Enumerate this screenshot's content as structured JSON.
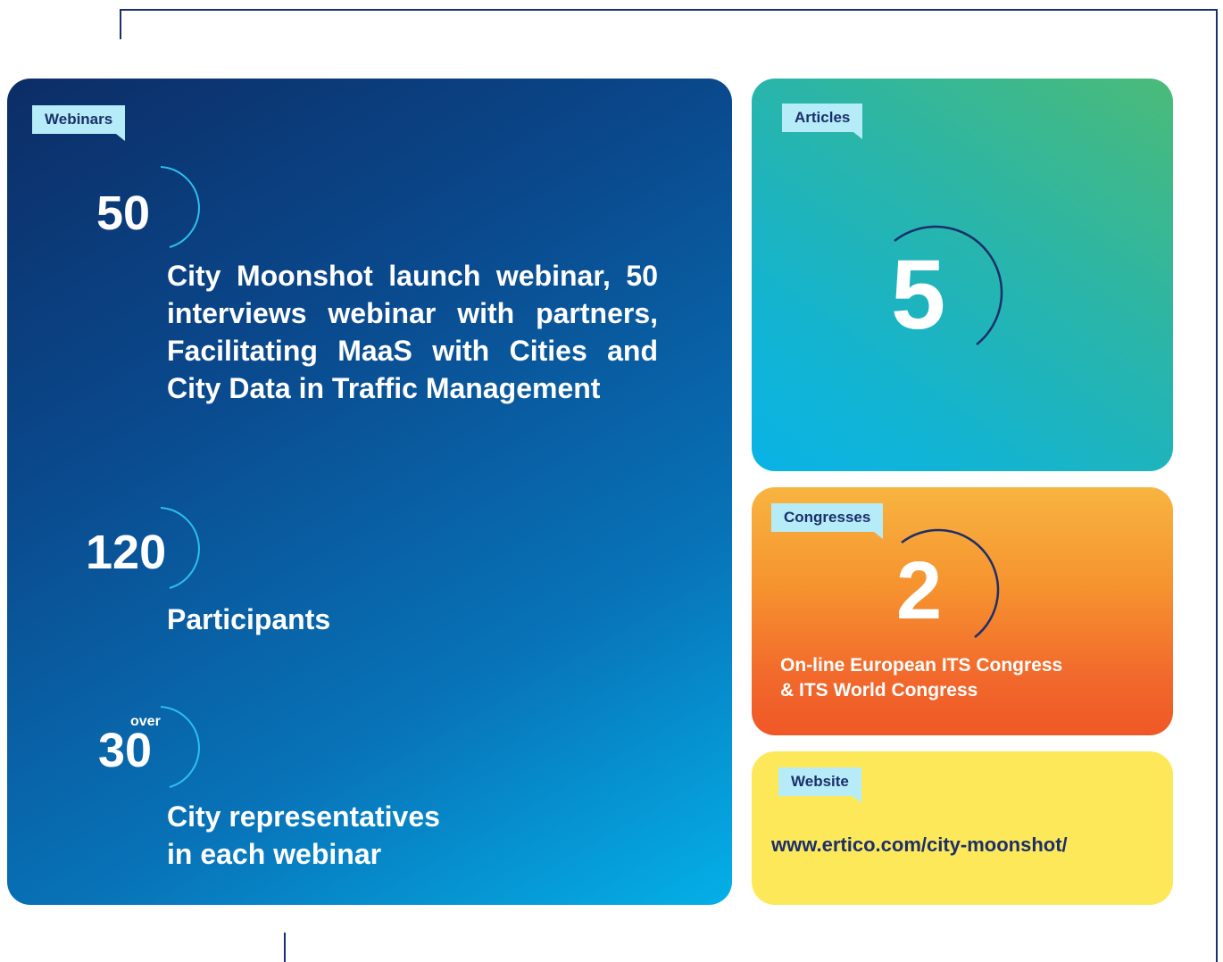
{
  "webinars": {
    "tag": "Webinars",
    "stat1": {
      "number": "50",
      "text": "City Moonshot launch webinar, 50 interviews webinar with partners, Facilitating MaaS with Cities and City Data in Traffic Management"
    },
    "stat2": {
      "number": "120",
      "text": "Participants"
    },
    "stat3": {
      "prefix": "over",
      "number": "30",
      "text_line1": "City representatives",
      "text_line2": "in each webinar"
    }
  },
  "articles": {
    "tag": "Articles",
    "number": "5"
  },
  "congresses": {
    "tag": "Congresses",
    "number": "2",
    "text_line1": "On-line European ITS Congress",
    "text_line2": "& ITS World Congress"
  },
  "website": {
    "tag": "Website",
    "url": "www.ertico.com/city-moonshot/"
  },
  "colors": {
    "navy": "#1b2f6b",
    "tag_bg": "#b5ecf8",
    "webinars_gradient_start": "#0c2d66",
    "webinars_gradient_end": "#04b0e8",
    "articles_gradient_start": "#4bbb78",
    "articles_gradient_end": "#09b3e6",
    "congresses_gradient_start": "#f8b440",
    "congresses_gradient_end": "#ef5826",
    "website_bg": "#fde85a"
  }
}
